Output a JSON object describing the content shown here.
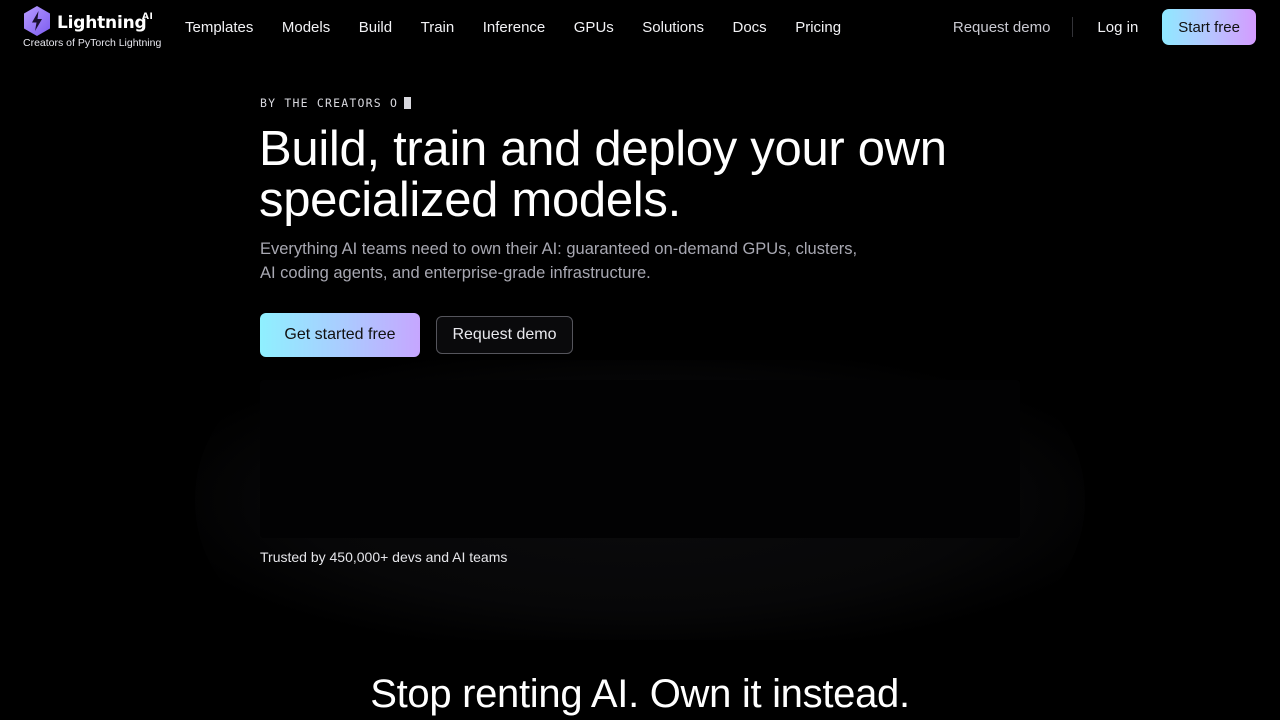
{
  "brand": {
    "name": "Lightning",
    "badge": "AI",
    "tagline": "Creators of PyTorch Lightning",
    "colors": {
      "primary_gradient": [
        "#8ff0ff",
        "#b6c6ff",
        "#d49bff"
      ],
      "logo": "#a78bfa"
    }
  },
  "nav": {
    "links": [
      "Templates",
      "Models",
      "Build",
      "Train",
      "Inference",
      "GPUs",
      "Solutions",
      "Docs",
      "Pricing"
    ],
    "request_demo": "Request demo",
    "login": "Log in",
    "start_free": "Start free"
  },
  "hero": {
    "eyebrow": "BY THE CREATORS O",
    "title_line1": "Build, train and deploy your own",
    "title_line2": "specialized models.",
    "subtitle_line1": "Everything AI teams need to own their AI: guaranteed on-demand GPUs, clusters,",
    "subtitle_line2": "AI coding agents, and enterprise-grade infrastructure.",
    "cta_primary": "Get started free",
    "cta_secondary": "Request demo",
    "trusted": "Trusted by 450,000+ devs and AI teams"
  },
  "section": {
    "title": "Stop renting AI. Own it instead."
  }
}
